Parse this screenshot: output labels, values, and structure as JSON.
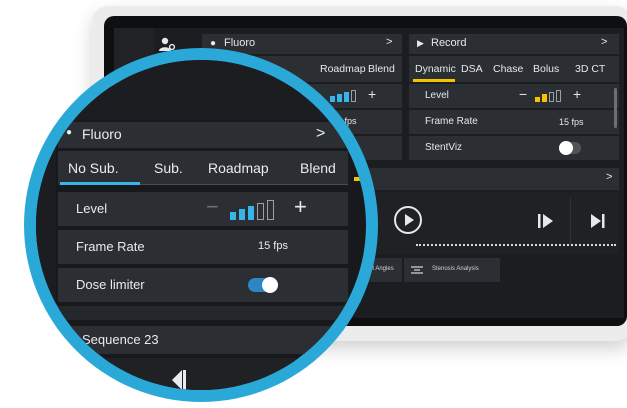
{
  "app": {
    "user_icon": "user-settings-icon"
  },
  "fluoro": {
    "title": "Fluoro",
    "chevron": ">",
    "tabs": [
      {
        "label": "No Sub.",
        "active": true
      },
      {
        "label": "Sub.",
        "active": false
      },
      {
        "label": "Roadmap",
        "active": false
      },
      {
        "label": "Blend",
        "active": false
      }
    ],
    "level_label": "Level",
    "level_minus": "−",
    "level_plus": "+",
    "level_value_fraction": 0.6,
    "frame_rate_label": "Frame Rate",
    "frame_rate_value": "15 fps",
    "dose_limiter_label": "Dose limiter",
    "dose_limiter_on": true
  },
  "record": {
    "title": "Record",
    "chevron": ">",
    "tabs": [
      {
        "label": "Dynamic",
        "active": true
      },
      {
        "label": "DSA",
        "active": false
      },
      {
        "label": "Chase",
        "active": false
      },
      {
        "label": "Bolus",
        "active": false
      },
      {
        "label": "3D CT",
        "active": false
      }
    ],
    "level_label": "Level",
    "level_minus": "−",
    "level_plus": "+",
    "frame_rate_label": "Frame Rate",
    "frame_rate_value": "15 fps",
    "stentviz_label": "StentViz",
    "stentviz_on": false
  },
  "sequence": {
    "title": "Sequence 23",
    "chevron": ">",
    "tools": [
      "Best Angles",
      "Stenosis Analysis"
    ]
  },
  "colors": {
    "accent": "#35b5e8",
    "lens_ring": "#2aa9d9",
    "panel": "#2b2e33",
    "screen": "#1b1d21"
  }
}
